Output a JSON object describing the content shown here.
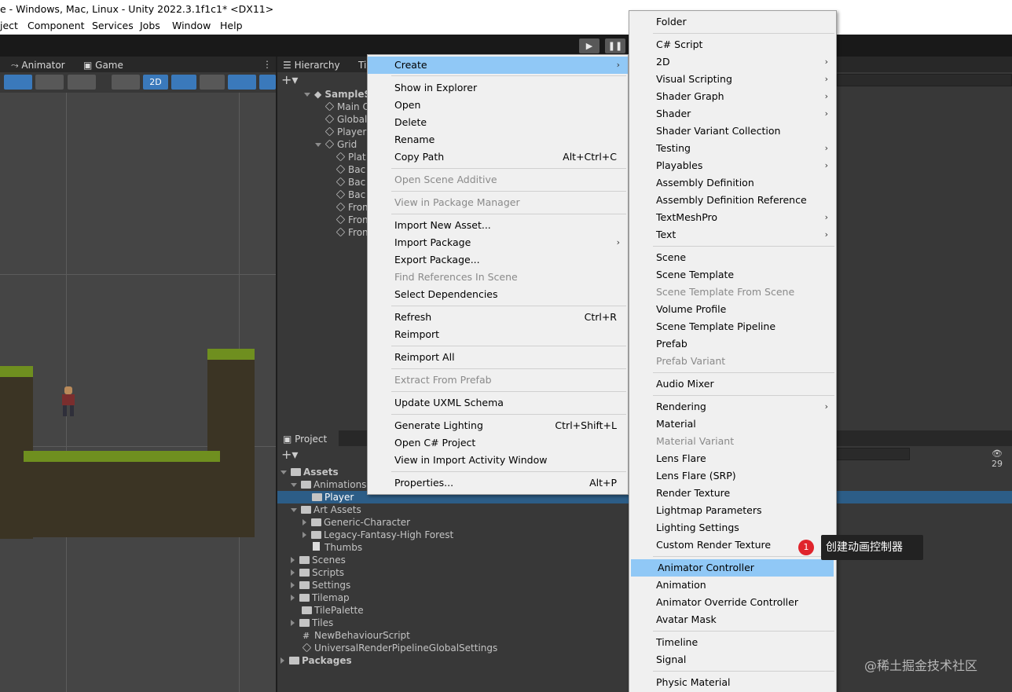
{
  "title_bar": {
    "text": "e - Windows, Mac, Linux - Unity 2022.3.1f1c1* <DX11>"
  },
  "menu_bar": [
    "ject",
    "Component",
    "Services",
    "Jobs",
    "Window",
    "Help"
  ],
  "scene_view": {
    "tabs": [
      "Animator",
      "Game"
    ],
    "toolbar_2d_label": "2D"
  },
  "hierarchy": {
    "tab": "Hierarchy",
    "tab2": "Ti",
    "scene_name": "SampleS",
    "items": [
      "Main C",
      "Global",
      "Player",
      "Grid",
      "Plat",
      "Bac",
      "Bac",
      "Bac",
      "Fron",
      "Fron",
      "Fron"
    ]
  },
  "project": {
    "tab": "Project",
    "items": [
      "Assets",
      "Animations",
      "Player",
      "Art Assets",
      "Generic-Character",
      "Legacy-Fantasy-High Forest",
      "Thumbs",
      "Scenes",
      "Scripts",
      "Settings",
      "Tilemap",
      "TilePalette",
      "Tiles",
      "NewBehaviourScript",
      "UniversalRenderPipelineGlobalSettings",
      "Packages"
    ],
    "hidden_count": "29"
  },
  "context_menu": {
    "items": [
      {
        "label": "Create",
        "shortcut": "",
        "arrow": "›"
      },
      {
        "label": "Show in Explorer",
        "shortcut": ""
      },
      {
        "label": "Open",
        "shortcut": ""
      },
      {
        "label": "Delete",
        "shortcut": ""
      },
      {
        "label": "Rename",
        "shortcut": ""
      },
      {
        "label": "Copy Path",
        "shortcut": "Alt+Ctrl+C"
      },
      {
        "label": "Open Scene Additive",
        "shortcut": ""
      },
      {
        "label": "View in Package Manager",
        "shortcut": ""
      },
      {
        "label": "Import New Asset...",
        "shortcut": ""
      },
      {
        "label": "Import Package",
        "shortcut": "",
        "arrow": "›"
      },
      {
        "label": "Export Package...",
        "shortcut": ""
      },
      {
        "label": "Find References In Scene",
        "shortcut": ""
      },
      {
        "label": "Select Dependencies",
        "shortcut": ""
      },
      {
        "label": "Refresh",
        "shortcut": "Ctrl+R"
      },
      {
        "label": "Reimport",
        "shortcut": ""
      },
      {
        "label": "Reimport All",
        "shortcut": ""
      },
      {
        "label": "Extract From Prefab",
        "shortcut": ""
      },
      {
        "label": "Update UXML Schema",
        "shortcut": ""
      },
      {
        "label": "Generate Lighting",
        "shortcut": "Ctrl+Shift+L"
      },
      {
        "label": "Open C# Project",
        "shortcut": ""
      },
      {
        "label": "View in Import Activity Window",
        "shortcut": ""
      },
      {
        "label": "Properties...",
        "shortcut": "Alt+P"
      }
    ]
  },
  "create_submenu": {
    "items": [
      "Folder",
      "C# Script",
      "2D",
      "Visual Scripting",
      "Shader Graph",
      "Shader",
      "Shader Variant Collection",
      "Testing",
      "Playables",
      "Assembly Definition",
      "Assembly Definition Reference",
      "TextMeshPro",
      "Text",
      "Scene",
      "Scene Template",
      "Scene Template From Scene",
      "Volume Profile",
      "Scene Template Pipeline",
      "Prefab",
      "Prefab Variant",
      "Audio Mixer",
      "Rendering",
      "Material",
      "Material Variant",
      "Lens Flare",
      "Lens Flare (SRP)",
      "Render Texture",
      "Lightmap Parameters",
      "Lighting Settings",
      "Custom Render Texture",
      "Animator Controller",
      "Animation",
      "Animator Override Controller",
      "Avatar Mask",
      "Timeline",
      "Signal",
      "Physic Material"
    ],
    "highlighted": "Animator Controller"
  },
  "annotation": {
    "badge": "1",
    "tooltip": "创建动画控制器"
  },
  "watermark": "@稀土掘金技术社区"
}
